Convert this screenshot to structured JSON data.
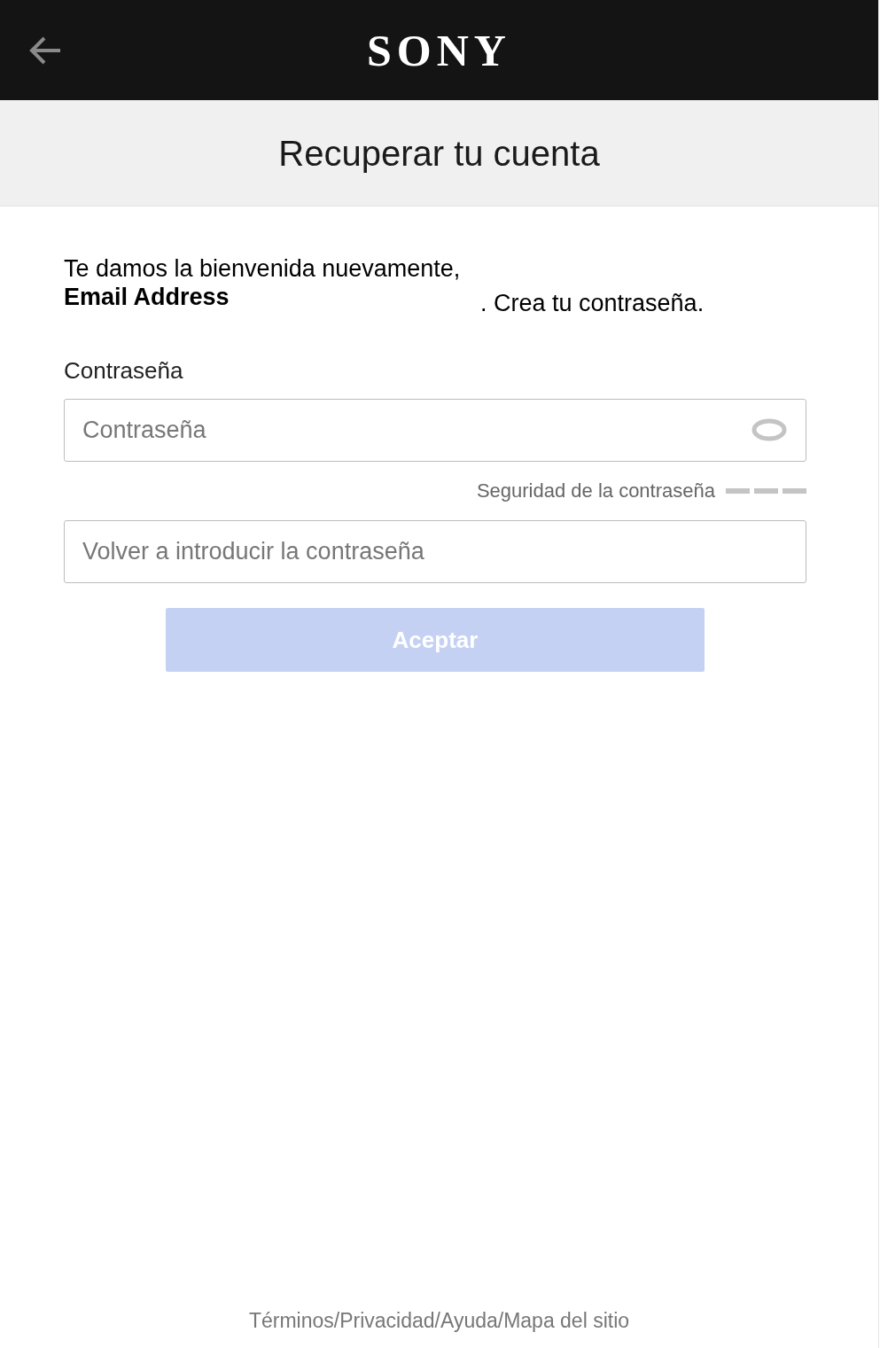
{
  "header": {
    "logo": "SONY"
  },
  "title": "Recuperar tu cuenta",
  "welcome": {
    "line": "Te damos la bienvenida nuevamente,",
    "email": "Email Address",
    "sentence": ". Crea tu contraseña."
  },
  "password_label": "Contraseña",
  "password_field": {
    "placeholder": "Contraseña"
  },
  "strength": {
    "label": "Seguridad de la contraseña"
  },
  "confirm_field": {
    "placeholder": "Volver a introducir la contraseña"
  },
  "submit": {
    "label": "Aceptar",
    "disabled": true
  },
  "footer": {
    "separator": "/",
    "links": [
      "Términos",
      "Privacidad",
      "Ayuda",
      "Mapa del sitio"
    ]
  }
}
